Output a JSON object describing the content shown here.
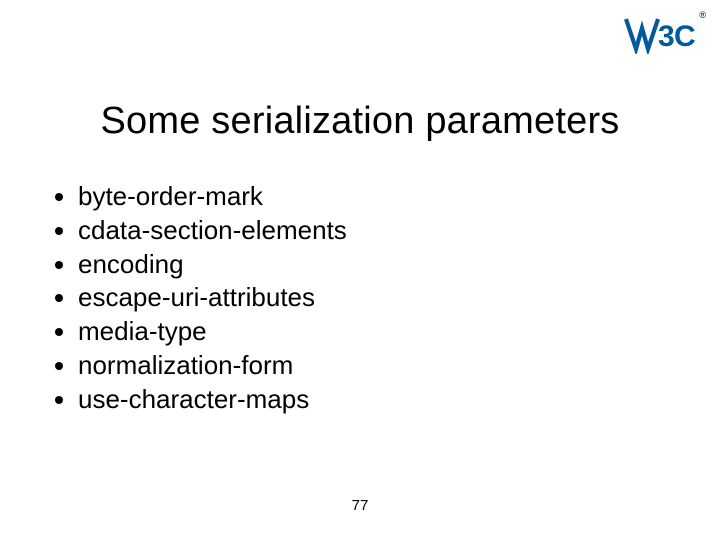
{
  "logo": {
    "name": "W3C"
  },
  "registered_mark": "®",
  "title": "Some serialization parameters",
  "bullets": [
    "byte-order-mark",
    "cdata-section-elements",
    "encoding",
    "escape-uri-attributes",
    "media-type",
    "normalization-form",
    "use-character-maps"
  ],
  "page_number": "77"
}
